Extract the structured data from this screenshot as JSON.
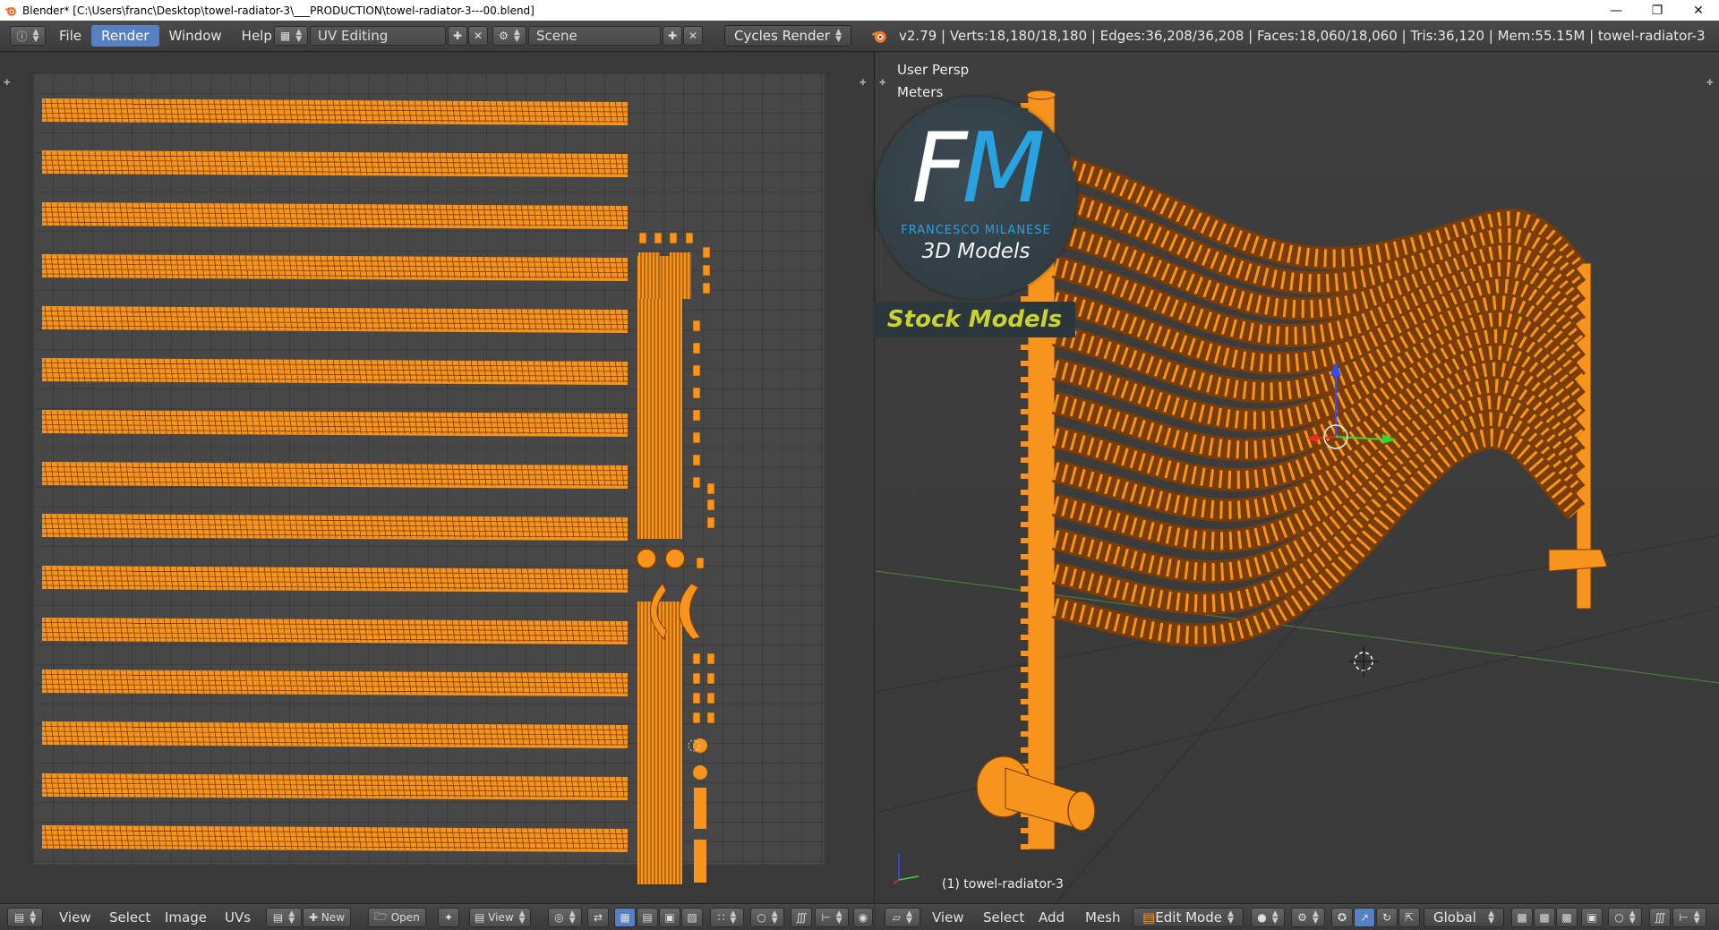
{
  "window": {
    "title": "Blender* [C:\\Users\\franc\\Desktop\\towel-radiator-3\\___PRODUCTION\\towel-radiator-3---00.blend]",
    "minimize_icon": "minimize-icon",
    "maximize_icon": "restore-icon",
    "close_icon": "close-icon"
  },
  "header": {
    "info_icon": "info-icon",
    "menus": [
      "File",
      "Render",
      "Window",
      "Help"
    ],
    "active_menu": "Render",
    "screen_layout": "UV Editing",
    "scene": "Scene",
    "render_engine": "Cycles Render",
    "stats": "v2.79 | Verts:18,180/18,180 | Edges:36,208/36,208 | Faces:18,060/18,060 | Tris:36,120 | Mem:55.15M | towel-radiator-3"
  },
  "uv_editor": {
    "menus": [
      "View",
      "Select",
      "Image",
      "UVs"
    ],
    "new_label": "New",
    "open_label": "Open",
    "view_label": "View"
  },
  "viewport": {
    "view_name": "User Persp",
    "units": "Meters",
    "object_label": "(1) towel-radiator-3",
    "menus": [
      "View",
      "Select",
      "Add",
      "Mesh"
    ],
    "mode": "Edit Mode",
    "orientation": "Global"
  },
  "logo": {
    "letter_f": "F",
    "letter_m": "M",
    "name": "FRANCESCO MILANESE",
    "subtitle": "3D Models",
    "banner": "Stock Models"
  },
  "colors": {
    "accent": "#5680c2",
    "mesh": "#f7941d",
    "mesh_dark": "#7a3d08",
    "logo_blue": "#29a3e0",
    "logo_yellow": "#c8d42c"
  }
}
